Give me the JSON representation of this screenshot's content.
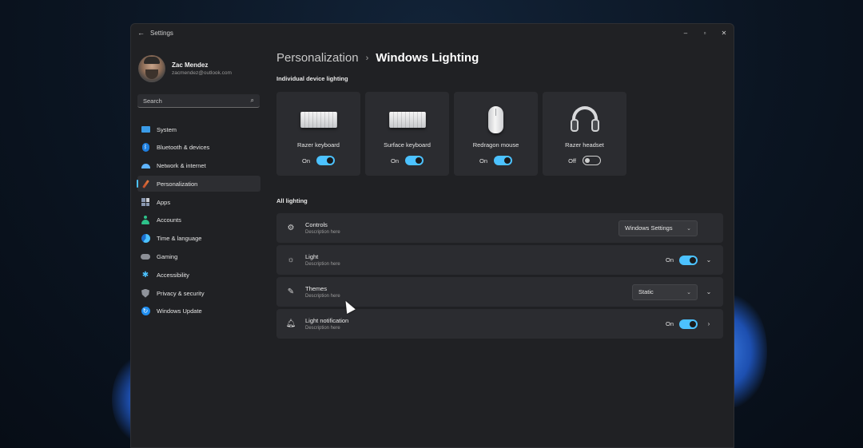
{
  "window": {
    "title": "Settings"
  },
  "profile": {
    "name": "Zac Mendez",
    "email": "zacmendez@outlook.com"
  },
  "search": {
    "placeholder": "Search"
  },
  "sidebar": {
    "items": [
      {
        "label": "System",
        "icon": "system-icon"
      },
      {
        "label": "Bluetooth & devices",
        "icon": "bluetooth-icon"
      },
      {
        "label": "Network & internet",
        "icon": "wifi-icon"
      },
      {
        "label": "Personalization",
        "icon": "brush-icon",
        "active": true
      },
      {
        "label": "Apps",
        "icon": "apps-icon"
      },
      {
        "label": "Accounts",
        "icon": "person-icon"
      },
      {
        "label": "Time & language",
        "icon": "globe-clock-icon"
      },
      {
        "label": "Gaming",
        "icon": "gamepad-icon"
      },
      {
        "label": "Accessibility",
        "icon": "accessibility-icon"
      },
      {
        "label": "Privacy & security",
        "icon": "shield-icon"
      },
      {
        "label": "Windows Update",
        "icon": "update-icon"
      }
    ]
  },
  "breadcrumb": {
    "parent": "Personalization",
    "separator": "›",
    "current": "Windows Lighting"
  },
  "devices_section": {
    "title": "Individual device lighting",
    "devices": [
      {
        "name": "Razer keyboard",
        "state": "On",
        "icon": "keyboard-icon"
      },
      {
        "name": "Surface keyboard",
        "state": "On",
        "icon": "keyboard-icon"
      },
      {
        "name": "Redragon mouse",
        "state": "On",
        "icon": "mouse-icon"
      },
      {
        "name": "Razer headset",
        "state": "Off",
        "icon": "headset-icon"
      }
    ]
  },
  "all_lighting": {
    "title": "All lighting",
    "rows": [
      {
        "title": "Controls",
        "description": "Description here",
        "icon": "gear-icon",
        "dropdown": "Windows Settings"
      },
      {
        "title": "Light",
        "description": "Description here",
        "icon": "sun-icon",
        "state": "On"
      },
      {
        "title": "Themes",
        "description": "Description here",
        "icon": "pen-icon",
        "dropdown": "Static"
      },
      {
        "title": "Light notification",
        "description": "Description here",
        "icon": "bell-icon",
        "state": "On"
      }
    ]
  },
  "colors": {
    "accent": "#4cc2ff",
    "window_bg": "#202124",
    "card_bg": "#2b2c30"
  }
}
